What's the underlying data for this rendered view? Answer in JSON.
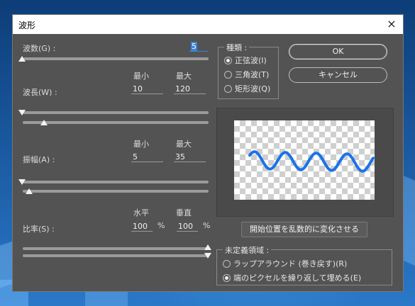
{
  "dialog": {
    "title": "波形",
    "close_icon": "×"
  },
  "generators": {
    "label": "波数(G) :",
    "value": "5"
  },
  "wavelength": {
    "label": "波長(W) :",
    "min_header": "最小",
    "max_header": "最大",
    "min_value": "10",
    "max_value": "120"
  },
  "amplitude": {
    "label": "振幅(A) :",
    "min_header": "最小",
    "max_header": "最大",
    "min_value": "5",
    "max_value": "35"
  },
  "scale": {
    "label": "比率(S) :",
    "horizontal_header": "水平",
    "vertical_header": "垂直",
    "horizontal_value": "100",
    "vertical_value": "100",
    "unit": "%"
  },
  "type_group": {
    "title": "種類 :",
    "options": [
      {
        "label": "正弦波(I)",
        "selected": true
      },
      {
        "label": "三角波(T)",
        "selected": false
      },
      {
        "label": "矩形波(Q)",
        "selected": false
      }
    ]
  },
  "buttons": {
    "ok": "OK",
    "cancel": "キャンセル",
    "randomize": "開始位置を乱数的に変化させる"
  },
  "undefined_areas": {
    "title": "未定義領域 :",
    "options": [
      {
        "label": "ラップアラウンド (巻き戻す)(R)",
        "selected": false
      },
      {
        "label": "端のピクセルを繰り返して埋める(E)",
        "selected": true
      }
    ]
  },
  "preview": {
    "wave_color": "#1a73e8",
    "cycles": 4
  },
  "sliders": {
    "generators_level": 0.0,
    "wavelength_min_level": 0.0,
    "wavelength_max_level": 0.12,
    "amplitude_min_level": 0.0,
    "amplitude_max_level": 0.04,
    "scale_horizontal_level": 1.0,
    "scale_vertical_level": 1.0
  }
}
